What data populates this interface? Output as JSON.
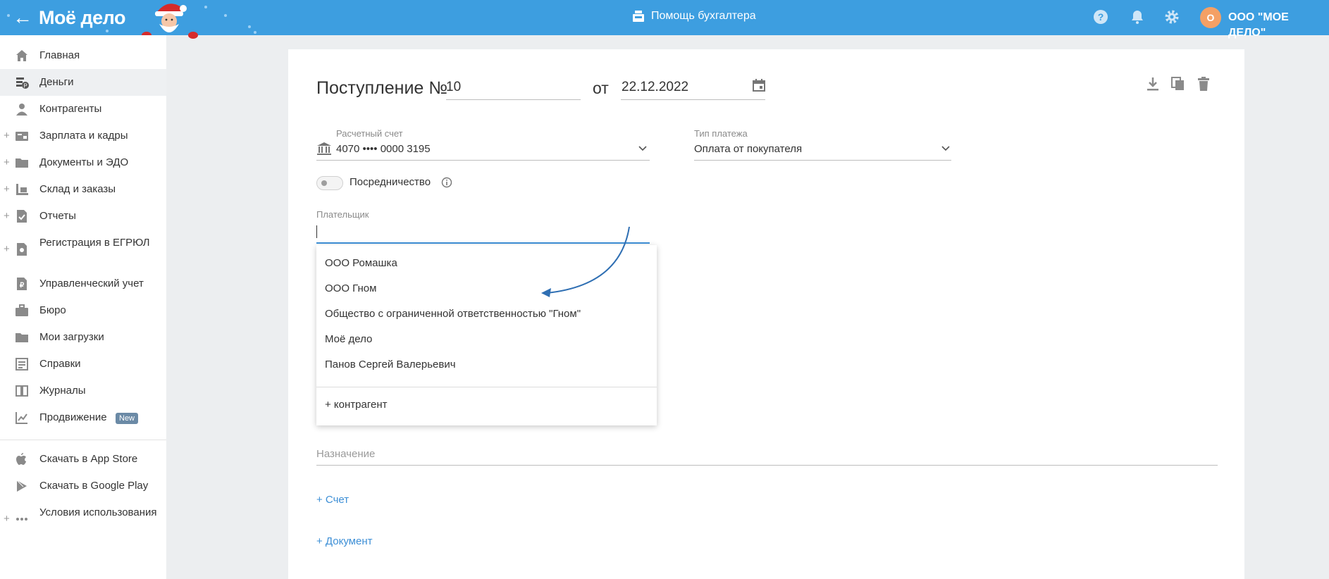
{
  "header": {
    "back_icon": "arrow-left-icon",
    "logo": "Моё дело",
    "helper_label": "Помощь бухгалтера",
    "org_initial": "О",
    "org_name": "ООО \"МОЕ ДЕЛО\"",
    "accent_color": "#3d9ee0"
  },
  "sidebar": {
    "items": [
      {
        "label": "Главная",
        "icon": "home-icon",
        "expandable": false
      },
      {
        "label": "Деньги",
        "icon": "money-icon",
        "expandable": false,
        "active": true
      },
      {
        "label": "Контрагенты",
        "icon": "contractors-icon",
        "expandable": false
      },
      {
        "label": "Зарплата и кадры",
        "icon": "salary-icon",
        "expandable": true
      },
      {
        "label": "Документы и ЭДО",
        "icon": "folder-icon",
        "expandable": true
      },
      {
        "label": "Склад и заказы",
        "icon": "warehouse-icon",
        "expandable": true
      },
      {
        "label": "Отчеты",
        "icon": "report-icon",
        "expandable": true
      },
      {
        "label": "Регистрация в ЕГРЮЛ",
        "icon": "registration-icon",
        "expandable": true
      },
      {
        "label": "Управленческий учет",
        "icon": "management-icon",
        "expandable": false
      },
      {
        "label": "Бюро",
        "icon": "briefcase-icon",
        "expandable": false
      },
      {
        "label": "Мои загрузки",
        "icon": "folder-icon",
        "expandable": false
      },
      {
        "label": "Справки",
        "icon": "list-icon",
        "expandable": false
      },
      {
        "label": "Журналы",
        "icon": "journal-icon",
        "expandable": false
      },
      {
        "label": "Продвижение",
        "icon": "chart-icon",
        "expandable": false,
        "badge": "New"
      }
    ],
    "bottom_items": [
      {
        "label": "Скачать в App Store",
        "icon": "apple-icon"
      },
      {
        "label": "Скачать в Google Play",
        "icon": "google-play-icon"
      },
      {
        "label": "Условия использования",
        "icon": "more-icon",
        "expandable": true
      }
    ]
  },
  "document": {
    "title": "Поступление №",
    "number": "10",
    "date_prefix": "от",
    "date": "22.12.2022",
    "account_label": "Расчетный счет",
    "account_value": "4070 •••• 0000 3195",
    "payment_type_label": "Тип платежа",
    "payment_type_value": "Оплата от покупателя",
    "mediation_label": "Посредничество",
    "payer_label": "Плательщик",
    "payer_value": "",
    "purpose_placeholder": "Назначение",
    "add_invoice": "+ Счет",
    "add_document": "+ Документ"
  },
  "payer_dropdown": {
    "options": [
      "ООО Ромашка",
      "ООО Гном",
      "Общество с ограниченной ответственностью \"Гном\"",
      "Моё дело",
      "Панов Сергей Валерьевич"
    ],
    "add_contractor": "+ контрагент"
  }
}
